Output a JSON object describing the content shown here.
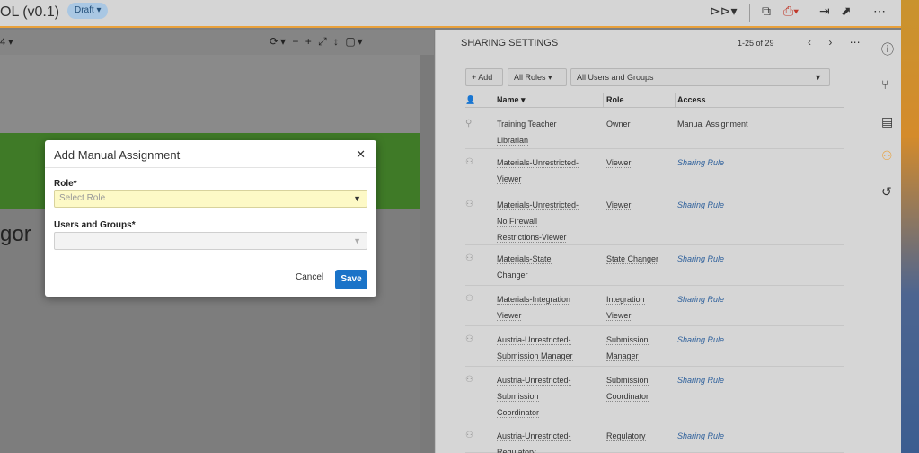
{
  "topbar": {
    "doc_title": "OL (v0.1)",
    "draft_label": "Draft",
    "icons": [
      "workflow-icon",
      "copy-icon",
      "pdf-icon",
      "export-icon",
      "open-external-icon",
      "more-icon"
    ]
  },
  "docpane": {
    "page_indicator": "4",
    "fragment_text": "gor"
  },
  "modal": {
    "title": "Add Manual Assignment",
    "role_label": "Role*",
    "role_placeholder": "Select Role",
    "users_label": "Users and Groups*",
    "users_value": "",
    "cancel_label": "Cancel",
    "save_label": "Save"
  },
  "sharing": {
    "title": "SHARING SETTINGS",
    "count": "1-25 of 29",
    "add_label": "+ Add",
    "roles_filter": "All Roles",
    "users_filter": "All Users and Groups",
    "columns": [
      "Name",
      "Role",
      "Access"
    ],
    "rows": [
      {
        "name1": "Training Teacher",
        "name2": "Librarian",
        "name3": "",
        "role1": "Owner",
        "role2": "",
        "access": "Manual Assignment",
        "rule": false
      },
      {
        "name1": "Materials-Unrestricted-",
        "name2": "Viewer",
        "name3": "",
        "role1": "Viewer",
        "role2": "",
        "access": "Sharing Rule",
        "rule": true
      },
      {
        "name1": "Materials-Unrestricted-",
        "name2": "No Firewall",
        "name3": "Restrictions-Viewer",
        "role1": "Viewer",
        "role2": "",
        "access": "Sharing Rule",
        "rule": true
      },
      {
        "name1": "Materials-State",
        "name2": "Changer",
        "name3": "",
        "role1": "State Changer",
        "role2": "",
        "access": "Sharing Rule",
        "rule": true
      },
      {
        "name1": "Materials-Integration",
        "name2": "Viewer",
        "name3": "",
        "role1": "Integration",
        "role2": "Viewer",
        "access": "Sharing Rule",
        "rule": true
      },
      {
        "name1": "Austria-Unrestricted-",
        "name2": "Submission Manager",
        "name3": "",
        "role1": "Submission",
        "role2": "Manager",
        "access": "Sharing Rule",
        "rule": true
      },
      {
        "name1": "Austria-Unrestricted-",
        "name2": "Submission",
        "name3": "Coordinator",
        "role1": "Submission",
        "role2": "Coordinator",
        "access": "Sharing Rule",
        "rule": true
      },
      {
        "name1": "Austria-Unrestricted-",
        "name2": "Regulatory",
        "name3": "",
        "role1": "Regulatory",
        "role2": "",
        "access": "Sharing Rule",
        "rule": true
      }
    ]
  },
  "rail": {
    "icons": [
      "info-icon",
      "branch-icon",
      "document-icon",
      "sharing-icon",
      "history-icon"
    ]
  },
  "colors": {
    "accent": "#e9a13b",
    "primary_button": "#1a73c8",
    "green_banner": "#3f7a27",
    "rule_link": "#2c5f9b"
  }
}
